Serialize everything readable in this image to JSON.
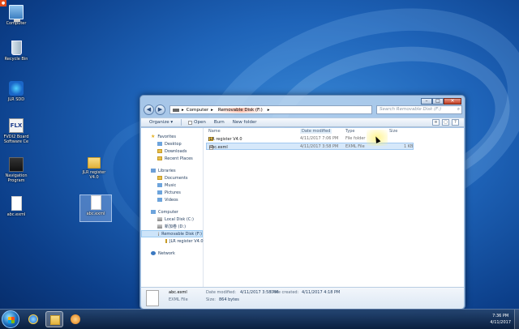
{
  "desktop": {
    "icons": [
      {
        "label": "Computer"
      },
      {
        "label": "Recycle Bin"
      },
      {
        "label": "JLR SDD"
      },
      {
        "label": "FVDI2 Board Software Ce"
      },
      {
        "label": "Navigation Program"
      },
      {
        "label": "abc.exml"
      },
      {
        "label": "JLR register V4.0"
      },
      {
        "label": "abc.exml"
      }
    ]
  },
  "window": {
    "address": {
      "segments": [
        "Computer",
        "Removable Disk (F:)"
      ],
      "separator": "▸"
    },
    "search_placeholder": "Search Removable Disk (F:)",
    "controls": {
      "minimize": "–",
      "maximize": "□",
      "close": "✕"
    },
    "toolbar": {
      "organize": "Organize ▾",
      "open": "Open",
      "burn": "Burn",
      "new_folder": "New folder"
    },
    "nav": {
      "favorites": "Favorites",
      "desktop": "Desktop",
      "downloads": "Downloads",
      "recent": "Recent Places",
      "libraries": "Libraries",
      "documents": "Documents",
      "music": "Music",
      "pictures": "Pictures",
      "videos": "Videos",
      "computer": "Computer",
      "local_disk": "Local Disk (C:)",
      "new_volume": "新加卷 (D:)",
      "removable": "Removable Disk (F:)",
      "jlr_folder": "JLR register V4.0",
      "network": "Network"
    },
    "columns": {
      "name": "Name",
      "date": "Date modified",
      "type": "Type",
      "size": "Size"
    },
    "files": [
      {
        "name": "JLR register V4.0",
        "date": "4/11/2017 7:06 PM",
        "type": "File folder",
        "size": ""
      },
      {
        "name": "abc.exml",
        "date": "4/11/2017 3:58 PM",
        "type": "EXML File",
        "size": "1 KB"
      }
    ],
    "details": {
      "filename": "abc.exml",
      "modified_label": "Date modified:",
      "modified_value": "4/11/2017 3:58 PM",
      "created_label": "Date created:",
      "created_value": "4/11/2017 4:18 PM",
      "type": "EXML File",
      "size_label": "Size:",
      "size_value": "864 bytes"
    }
  },
  "taskbar": {
    "time": "7:36 PM",
    "date": "4/11/2017"
  },
  "icons": {
    "start": "windows-start-icon",
    "ie": "internet-explorer-icon",
    "explorer": "folder-icon",
    "media": "media-player-icon"
  }
}
